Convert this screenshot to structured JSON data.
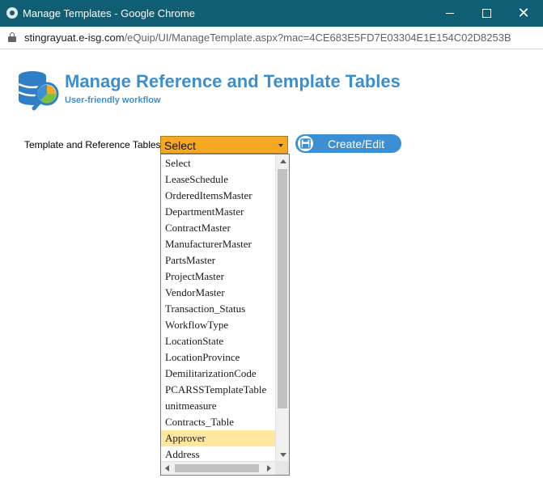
{
  "window": {
    "title": "Manage Templates - Google Chrome",
    "accent": "#0f5e73"
  },
  "address": {
    "host": "stingrayuat.e-isg.com",
    "path": "/eQuip/UI/ManageTemplate.aspx?mac=4CE683E5FD7E03304E1E154C02D8253B"
  },
  "header": {
    "title": "Manage Reference and Template Tables",
    "subtitle": "User-friendly workflow",
    "color": "#3b8fd0"
  },
  "form": {
    "label": "Template and Reference Tables",
    "selected": "Select",
    "select_color": "#f7a823",
    "button_label": "Create/Edit",
    "button_color": "#3c8fd2",
    "button_icon": "save-icon"
  },
  "dropdown": {
    "options": [
      {
        "label": "Select"
      },
      {
        "label": "LeaseSchedule"
      },
      {
        "label": "OrderedItemsMaster"
      },
      {
        "label": "DepartmentMaster"
      },
      {
        "label": "ContractMaster"
      },
      {
        "label": "ManufacturerMaster"
      },
      {
        "label": "PartsMaster"
      },
      {
        "label": "ProjectMaster"
      },
      {
        "label": "VendorMaster"
      },
      {
        "label": "Transaction_Status"
      },
      {
        "label": "WorkflowType"
      },
      {
        "label": "LocationState"
      },
      {
        "label": "LocationProvince"
      },
      {
        "label": "DemilitarizationCode"
      },
      {
        "label": "PCARSSTemplateTable"
      },
      {
        "label": "unitmeasure"
      },
      {
        "label": "Contracts_Table"
      },
      {
        "label": "Approver",
        "highlighted": true
      },
      {
        "label": "Address"
      }
    ],
    "highlight_color": "#ffe7a0"
  }
}
